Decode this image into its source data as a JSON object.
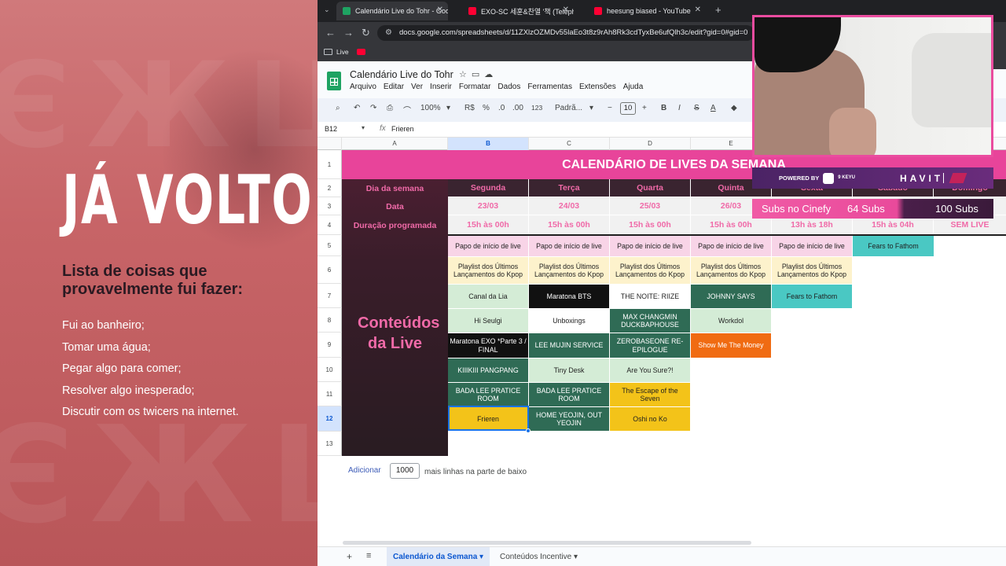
{
  "overlay": {
    "headline": "JÁ VOLTO!",
    "list_title": "Lista de coisas que provavelmente fui fazer:",
    "items": [
      "Fui ao banheiro;",
      "Tomar uma água;",
      "Pegar algo para comer;",
      "Resolver algo inesperado;",
      "Discutir com os twicers na internet."
    ]
  },
  "browser": {
    "tabs": [
      {
        "label": "Calendário Live do Tohr - Goog",
        "color": "#1ea362"
      },
      {
        "label": "EXO-SC 세훈&찬열 '책 (Teleph",
        "color": "#ff0033"
      },
      {
        "label": "heesung biased - YouTube",
        "color": "#ff0033"
      }
    ],
    "url": "docs.google.com/spreadsheets/d/11ZXlzOZMDv55laEo3t8z9rAh8Rk3cdTyxBe6ufQlh3c/edit?gid=0#gid=0",
    "bookmark": "Live"
  },
  "sheets": {
    "doc_title": "Calendário Live do Tohr",
    "menus": [
      "Arquivo",
      "Editar",
      "Ver",
      "Inserir",
      "Formatar",
      "Dados",
      "Ferramentas",
      "Extensões",
      "Ajuda"
    ],
    "toolbar": {
      "zoom": "100%",
      "currency": "R$",
      "percent": "%",
      "decimals": ".0",
      "decimals2": ".00",
      "num": "123",
      "font": "Padrã...",
      "font_size": "10"
    },
    "cell_ref": "B12",
    "formula_value": "Frieren",
    "columns": [
      "A",
      "B",
      "C",
      "D",
      "E"
    ],
    "rows": [
      "1",
      "2",
      "3",
      "4",
      "5",
      "6",
      "7",
      "8",
      "9",
      "10",
      "11",
      "12",
      "13"
    ]
  },
  "calendar": {
    "banner": "CALENDÁRIO DE LIVES DA SEMANA",
    "row_labels": [
      "Dia da semana",
      "Data",
      "Duração programada"
    ],
    "content_label": "Conteúdos da Live",
    "days": [
      {
        "name": "Segunda",
        "date": "23/03",
        "hours": "15h às 00h"
      },
      {
        "name": "Terça",
        "date": "24/03",
        "hours": "15h às 00h"
      },
      {
        "name": "Quarta",
        "date": "25/03",
        "hours": "15h às 00h"
      },
      {
        "name": "Quinta",
        "date": "26/03",
        "hours": "15h às 00h"
      },
      {
        "name": "Sexta",
        "date": "",
        "hours": "13h às 18h"
      },
      {
        "name": "Sábado",
        "date": "",
        "hours": "15h às 04h"
      },
      {
        "name": "Domingo",
        "date": "",
        "hours": "SEM LIVE"
      }
    ],
    "entries": {
      "row5": [
        "Papo de início de live",
        "Papo de início de live",
        "Papo de início de live",
        "Papo de início de live",
        "Papo de início de live",
        "Fears to Fathom"
      ],
      "row6": [
        "Playlist dos Últimos Lançamentos do Kpop",
        "Playlist dos Últimos Lançamentos do Kpop",
        "Playlist dos Últimos Lançamentos do Kpop",
        "Playlist dos Últimos Lançamentos do Kpop",
        "Playlist dos Últimos Lançamentos do Kpop"
      ],
      "row7": [
        "Canal da Lia",
        "Maratona BTS",
        "THE NOITE: RIIZE",
        "JOHNNY SAYS",
        "Fears to Fathom"
      ],
      "row8": [
        "Hi Seulgi",
        "Unboxings",
        "MAX CHANGMIN DUCKBAPHOUSE",
        "Workdol"
      ],
      "row9": [
        "Maratona EXO *Parte 3 / FINAL",
        "LEE MUJIN SERVICE",
        "ZEROBASEONE RE-EPILOGUE",
        "Show Me The Money"
      ],
      "row10": [
        "KIIIKIII PANGPANG",
        "Tiny Desk",
        "Are You Sure?!"
      ],
      "row11": [
        "BADA LEE PRATICE ROOM",
        "BADA LEE PRATICE ROOM",
        "The Escape of the Seven"
      ],
      "row12": [
        "Frieren",
        "HOME YEOJIN, OUT YEOJIN",
        "Oshi no Ko"
      ]
    }
  },
  "add_rows": {
    "button": "Adicionar",
    "count": "1000",
    "suffix": "mais linhas na parte de baixo"
  },
  "sheet_tabs": [
    "Calendário da Semana",
    "Conteúdos Incentive"
  ],
  "stream": {
    "powered_by": "POWERED BY",
    "sponsor1": "9 KEYU",
    "sponsor2": "HAVIT",
    "subs_label": "Subs no Cinefy",
    "subs_current": "64 Subs",
    "subs_goal": "100 Subs"
  }
}
